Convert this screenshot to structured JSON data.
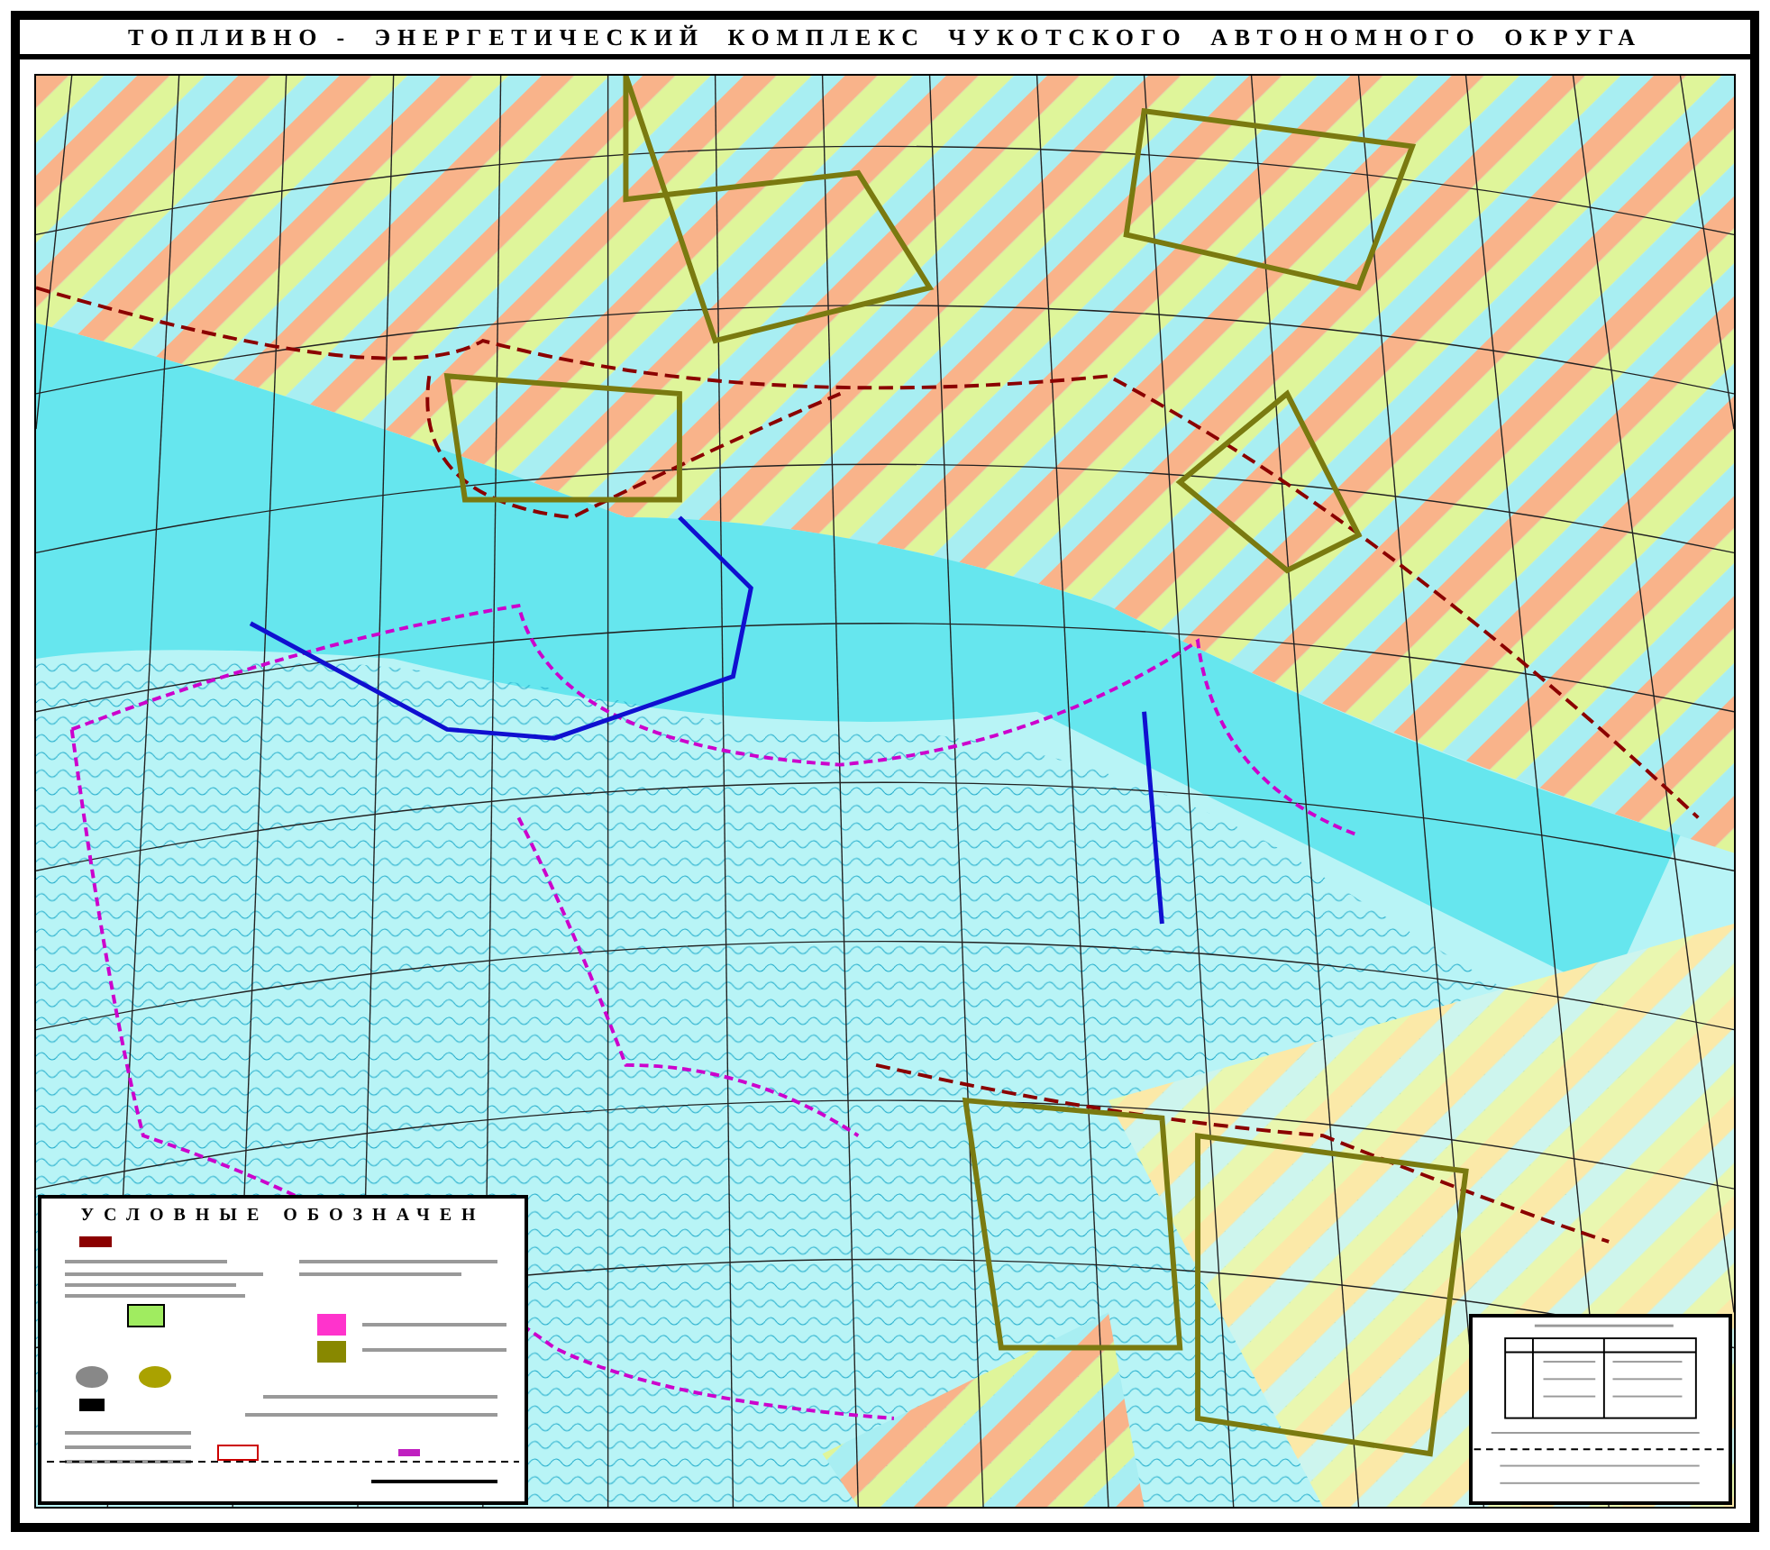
{
  "title": {
    "words": [
      "ТОПЛИВНО -",
      "ЭНЕРГЕТИЧЕСКИЙ",
      "КОМПЛЕКС",
      "ЧУКОТСКОГО",
      "АВТОНОМНОГО",
      "ОКРУГА"
    ]
  },
  "legend": {
    "title": "УСЛОВНЫЕ ОБОЗНАЧЕН"
  }
}
